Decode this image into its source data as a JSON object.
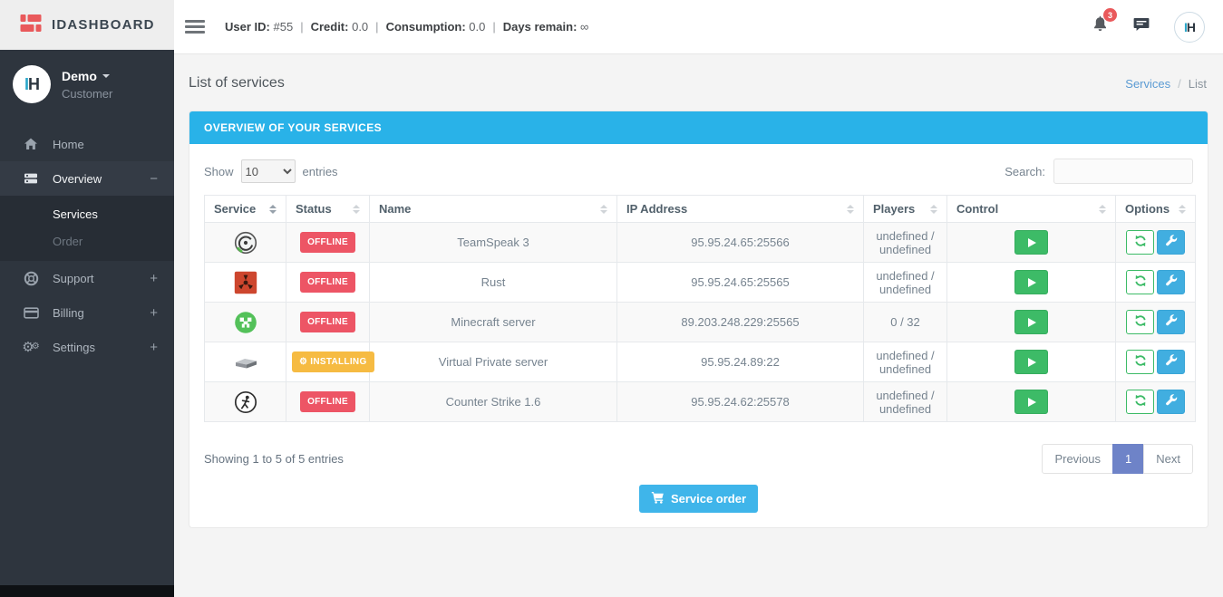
{
  "brand": {
    "name": "IDASHBOARD"
  },
  "topbar": {
    "separator": "|",
    "stats": [
      {
        "label": "User ID:",
        "value": "#55"
      },
      {
        "label": "Credit:",
        "value": "0.0"
      },
      {
        "label": "Consumption:",
        "value": "0.0"
      },
      {
        "label": "Days remain:",
        "value": "∞"
      }
    ],
    "notification_count": "3",
    "avatar_letters": {
      "first": "I",
      "second": "H"
    }
  },
  "sidebar": {
    "user_name": "Demo",
    "user_role": "Customer",
    "avatar_letters": {
      "first": "I",
      "second": "H"
    },
    "home_label": "Home",
    "overview_label": "Overview",
    "overview_toggle": "−",
    "services_label": "Services",
    "order_label": "Order",
    "support_label": "Support",
    "support_toggle": "+",
    "billing_label": "Billing",
    "billing_toggle": "+",
    "settings_label": "Settings",
    "settings_toggle": "+"
  },
  "page": {
    "title": "List of services",
    "breadcrumb": {
      "link": "Services",
      "separator": "/",
      "current": "List"
    }
  },
  "panel": {
    "heading": "OVERVIEW OF YOUR SERVICES",
    "show_label": "Show",
    "page_size": "10",
    "entries_label": "entries",
    "search_label": "Search:"
  },
  "table": {
    "columns": [
      "Service",
      "Status",
      "Name",
      "IP Address",
      "Players",
      "Control",
      "Options"
    ],
    "rows": [
      {
        "service": "TeamSpeak",
        "status": "OFFLINE",
        "status_type": "offline",
        "name": "TeamSpeak 3",
        "ip": "95.95.24.65:25566",
        "players": "undefined / undefined"
      },
      {
        "service": "Rust",
        "status": "OFFLINE",
        "status_type": "offline",
        "name": "Rust",
        "ip": "95.95.24.65:25565",
        "players": "undefined / undefined"
      },
      {
        "service": "Minecraft",
        "status": "OFFLINE",
        "status_type": "offline",
        "name": "Minecraft server",
        "ip": "89.203.248.229:25565",
        "players": "0 / 32"
      },
      {
        "service": "VPS",
        "status": "INSTALLING",
        "status_type": "installing",
        "name": "Virtual Private server",
        "ip": "95.95.24.89:22",
        "players": "undefined / undefined"
      },
      {
        "service": "Counter Strike",
        "status": "OFFLINE",
        "status_type": "offline",
        "name": "Counter Strike 1.6",
        "ip": "95.95.24.62:25578",
        "players": "undefined / undefined"
      }
    ]
  },
  "footer": {
    "info": "Showing 1 to 5 of 5 entries",
    "previous_label": "Previous",
    "current_page": "1",
    "next_label": "Next"
  },
  "order_button_label": "Service order",
  "icons": {
    "gear": "⚙"
  },
  "colors": {
    "panel_heading": "#29b2e8",
    "status_offline": "#ed5565",
    "status_installing": "#f6bb42",
    "control_green": "#3dbb67",
    "options_blue": "#41aee0",
    "pagination_active": "#6e83c8",
    "order_button": "#3fb5ea",
    "brand_red": "#e9595b"
  }
}
